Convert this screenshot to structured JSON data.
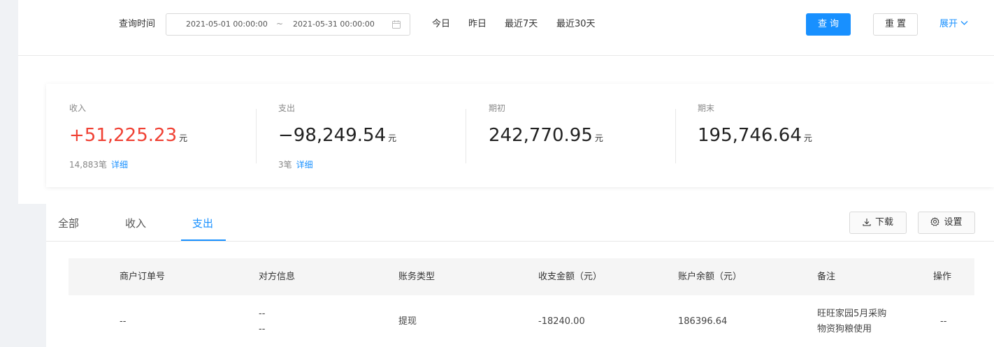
{
  "filter": {
    "label": "查询时间",
    "date_start": "2021-05-01 00:00:00",
    "date_separator": "~",
    "date_end": "2021-05-31 00:00:00",
    "quick_options": [
      "今日",
      "昨日",
      "最近7天",
      "最近30天"
    ],
    "query_label": "查询",
    "reset_label": "重置",
    "expand_label": "展开"
  },
  "summary": {
    "unit": "元",
    "detail_label": "详细",
    "income": {
      "label": "收入",
      "value": "+51,225.23",
      "count": "14,883笔"
    },
    "expense": {
      "label": "支出",
      "value": "−98,249.54",
      "count": "3笔"
    },
    "opening": {
      "label": "期初",
      "value": "242,770.95"
    },
    "closing": {
      "label": "期末",
      "value": "195,746.64"
    }
  },
  "tabs": [
    "全部",
    "收入",
    "支出"
  ],
  "active_tab": "支出",
  "toolbar": {
    "download_label": "下载",
    "settings_label": "设置"
  },
  "table": {
    "columns": [
      "商户订单号",
      "对方信息",
      "账务类型",
      "收支金额（元）",
      "账户余额（元）",
      "备注",
      "操作"
    ],
    "rows": [
      {
        "order_no": "--",
        "counterparty_line1": "--",
        "counterparty_line2": "--",
        "type": "提现",
        "amount": "-18240.00",
        "balance": "186396.64",
        "remark_line1": "旺旺家园5月采购",
        "remark_line2": "物资狗粮使用",
        "action": "--"
      }
    ]
  },
  "colors": {
    "primary": "#1890ff",
    "income": "#f04134"
  }
}
